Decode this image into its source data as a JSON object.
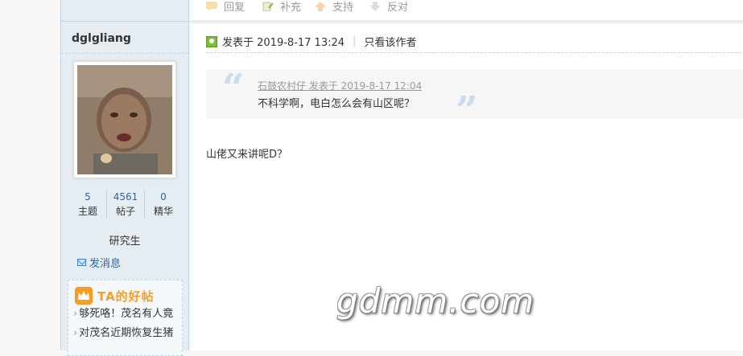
{
  "actions": {
    "reply": "回复",
    "supplement": "补充",
    "support": "支持",
    "oppose": "反对"
  },
  "user": {
    "name": "dglgliang",
    "stats": [
      {
        "value": "5",
        "label": "主题"
      },
      {
        "value": "4561",
        "label": "帖子"
      },
      {
        "value": "0",
        "label": "精华"
      }
    ],
    "rank": "研究生",
    "send_message": "发消息"
  },
  "good_posts": {
    "title": "TA的好帖",
    "items": [
      "够死咯！茂名有人竟",
      "对茂名近期恢复生猪"
    ]
  },
  "post": {
    "posted_at": "发表于 2019-8-17 13:24",
    "only_author": "只看该作者",
    "quote": {
      "meta": "石鼓农村仔 发表于 2019-8-17 12:04",
      "text": "不科学啊，电白怎么会有山区呢？"
    },
    "reply": "山佬又来讲呢D？"
  },
  "watermark": "gdmm.com",
  "colors": {
    "sidebar_bg": "#e5edf2",
    "link": "#336699",
    "accent": "#f89c23",
    "quote_mark": "#c9dcee"
  }
}
